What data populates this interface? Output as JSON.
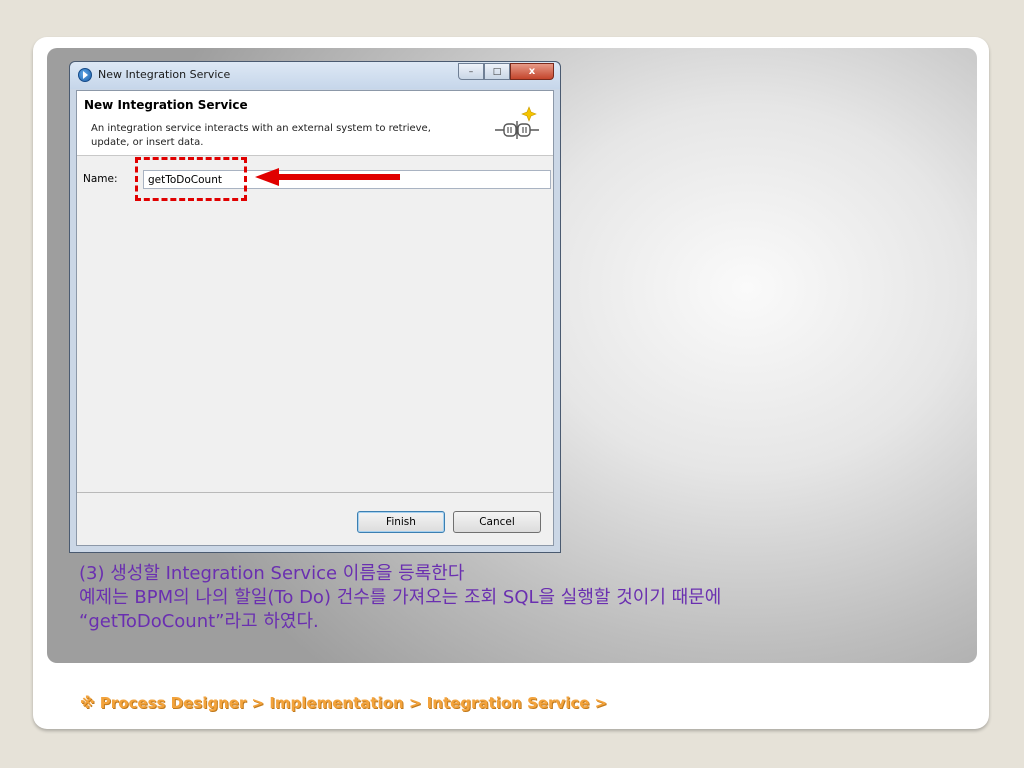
{
  "dialog": {
    "window_title": "New Integration Service",
    "heading": "New Integration Service",
    "description": "An integration service interacts with an external system to retrieve, update, or insert data.",
    "name_label": "Name:",
    "name_value": "getToDoCount",
    "finish_label": "Finish",
    "cancel_label": "Cancel",
    "minimize_glyph": "–",
    "maximize_glyph": "□",
    "close_glyph": "x"
  },
  "caption": {
    "line1": "(3) 생성할 Integration Service 이름을 등록한다",
    "line2": "예제는 BPM의 나의 할일(To Do) 건수를 가져오는 조회 SQL을 실행할 것이기 때문에",
    "line3": "“getToDoCount”라고 하였다."
  },
  "footer": {
    "breadcrumb": "※ Process Designer > Implementation > Integration Service >"
  },
  "colors": {
    "highlight": "#e00000",
    "caption_text": "#6a2fb0",
    "breadcrumb_text": "#f3a33c"
  }
}
